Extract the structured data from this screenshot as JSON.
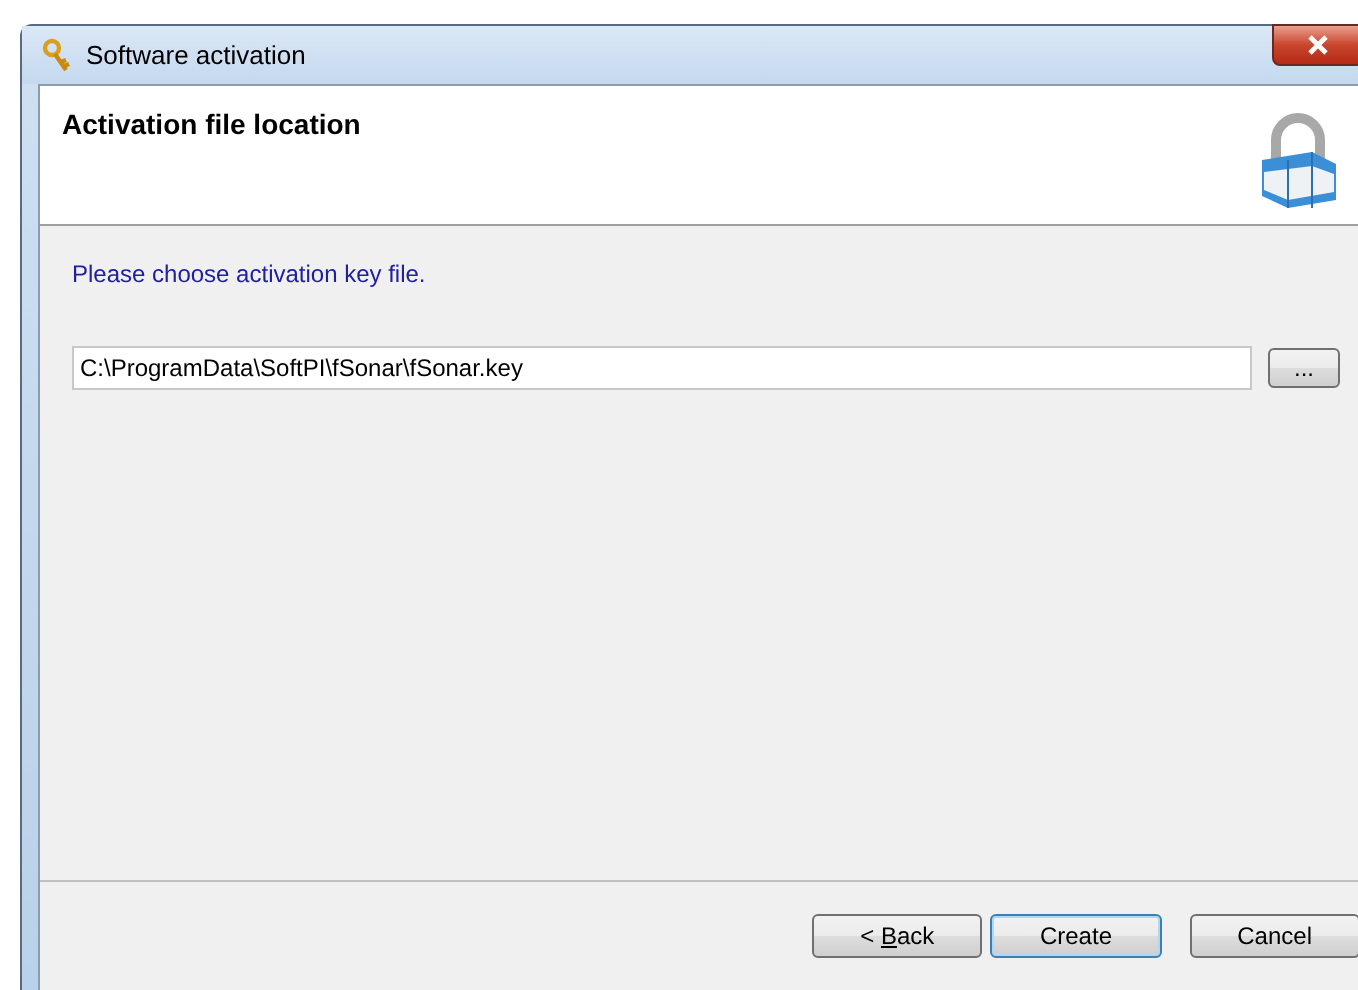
{
  "window": {
    "title": "Software activation"
  },
  "header": {
    "title": "Activation file location"
  },
  "body": {
    "prompt": "Please choose activation key file.",
    "file_field": {
      "value": "C:\\ProgramData\\SoftPI\\fSonar\\fSonar.key"
    },
    "browse_button": "..."
  },
  "buttons": [
    {
      "kind": "access",
      "before": "< ",
      "key": "B",
      "after": "ack",
      "default": false
    },
    {
      "kind": "plain",
      "label": "Create",
      "default": true
    },
    {
      "kind": "plain",
      "label": "Cancel",
      "default": false
    }
  ]
}
